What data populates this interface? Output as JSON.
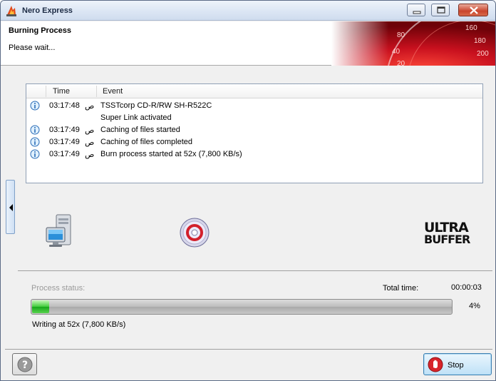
{
  "window": {
    "title": "Nero Express",
    "app_icon": "nero-flame-icon",
    "controls": {
      "minimize": "minimize-icon",
      "maximize": "maximize-icon",
      "close": "close-icon"
    }
  },
  "header": {
    "title": "Burning Process",
    "subtitle": "Please wait...",
    "speedometer": {
      "ticks": [
        "160",
        "180",
        "200",
        "80",
        "40",
        "20"
      ]
    }
  },
  "log": {
    "columns": {
      "time": "Time",
      "event": "Event"
    },
    "rows": [
      {
        "icon": "info-icon",
        "time": "03:17:48",
        "suffix": "ص",
        "event": "TSSTcorp CD-R/RW SH-R522C"
      },
      {
        "icon": "",
        "time": "",
        "suffix": "",
        "event": "Super Link activated"
      },
      {
        "icon": "info-icon",
        "time": "03:17:49",
        "suffix": "ص",
        "event": "Caching of files started"
      },
      {
        "icon": "info-icon",
        "time": "03:17:49",
        "suffix": "ص",
        "event": "Caching of files completed"
      },
      {
        "icon": "info-icon",
        "time": "03:17:49",
        "suffix": "ص",
        "event": "Burn process started at 52x (7,800 KB/s)"
      }
    ]
  },
  "icons": {
    "source": "computer-icon",
    "target": "disc-icon"
  },
  "logo": {
    "text_top": "ULTRA",
    "text_bottom": "BUFFER"
  },
  "progress": {
    "status_label": "Process status:",
    "total_label": "Total time:",
    "total_value": "00:00:03",
    "percent_value": 0.04,
    "percent_text": "4%",
    "writing_text": "Writing at 52x (7,800 KB/s)"
  },
  "buttons": {
    "help_icon": "help-icon",
    "stop_label": "Stop",
    "stop_icon": "stop-icon"
  },
  "colors": {
    "accent_red": "#c8101e",
    "progress_green": "#2fbf2f"
  }
}
